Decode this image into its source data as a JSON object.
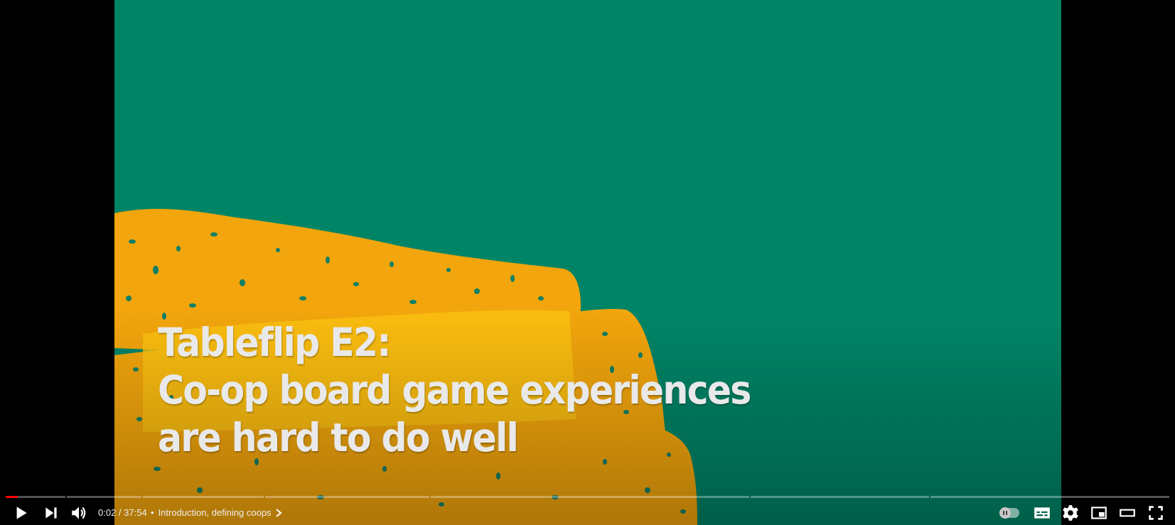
{
  "video": {
    "title_lines": [
      "Tableflip E2:",
      "Co-op board game experiences",
      "are hard to do well"
    ],
    "colors": {
      "background": "#008466",
      "splash": "#f2a50c",
      "splash_highlight": "#fbc210",
      "title": "#e9e9e9"
    }
  },
  "player": {
    "time_display": "0:02 / 37:54",
    "chapter_separator": "•",
    "chapter_title": "Introduction, defining coops",
    "progress_played_fraction": 0.0009,
    "autoplay_enabled": false
  },
  "icons": {
    "play": "play-icon",
    "next": "next-icon",
    "volume": "volume-icon",
    "chapter_chevron": "chevron-right-icon",
    "autoplay": "autoplay-toggle-icon",
    "captions": "subtitles-icon",
    "settings": "gear-icon",
    "miniplayer": "miniplayer-icon",
    "theater": "theater-mode-icon",
    "fullscreen": "fullscreen-icon"
  },
  "accent_color": "#ff0000"
}
